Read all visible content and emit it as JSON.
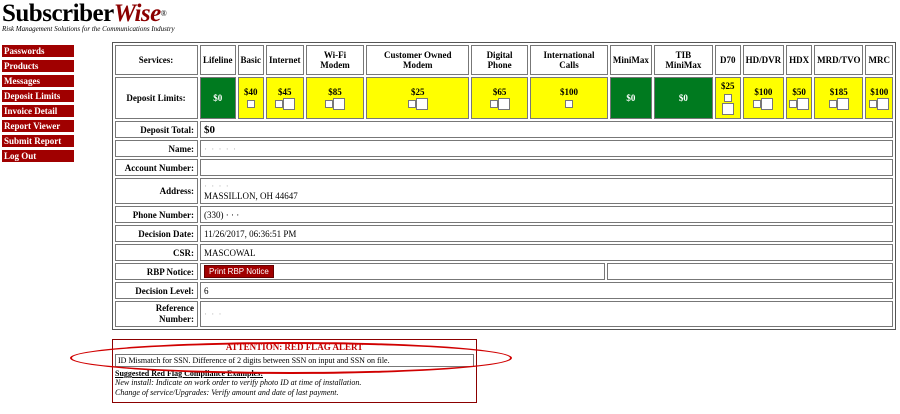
{
  "logo": {
    "part1": "Subscriber",
    "part2": "Wise",
    "reg": "®",
    "tagline": "Risk Management Solutions for the Communications Industry"
  },
  "menu": [
    "Passwords",
    "Products",
    "Messages",
    "Deposit Limits",
    "Invoice Detail",
    "Report Viewer",
    "Submit Report",
    "Log Out"
  ],
  "services_label": "Services:",
  "deposit_limits_label": "Deposit Limits:",
  "services": [
    {
      "name": "Lifeline",
      "limit": "$0",
      "color": "green",
      "checkbox": false,
      "box": false
    },
    {
      "name": "Basic",
      "limit": "$40",
      "color": "yellow",
      "checkbox": true,
      "box": false
    },
    {
      "name": "Internet",
      "limit": "$45",
      "color": "yellow",
      "checkbox": true,
      "box": true
    },
    {
      "name": "Wi-Fi Modem",
      "limit": "$85",
      "color": "yellow",
      "checkbox": true,
      "box": true
    },
    {
      "name": "Customer Owned Modem",
      "limit": "$25",
      "color": "yellow",
      "checkbox": true,
      "box": true
    },
    {
      "name": "Digital Phone",
      "limit": "$65",
      "color": "yellow",
      "checkbox": true,
      "box": true
    },
    {
      "name": "International Calls",
      "limit": "$100",
      "color": "yellow",
      "checkbox": true,
      "box": false
    },
    {
      "name": "MiniMax",
      "limit": "$0",
      "color": "green",
      "checkbox": false,
      "box": false
    },
    {
      "name": "TIB MiniMax",
      "limit": "$0",
      "color": "green",
      "checkbox": false,
      "box": false
    },
    {
      "name": "D70",
      "limit": "$25",
      "color": "yellow",
      "checkbox": true,
      "box": true
    },
    {
      "name": "HD/DVR",
      "limit": "$100",
      "color": "yellow",
      "checkbox": true,
      "box": true
    },
    {
      "name": "HDX",
      "limit": "$50",
      "color": "yellow",
      "checkbox": true,
      "box": true
    },
    {
      "name": "MRD/TVO",
      "limit": "$185",
      "color": "yellow",
      "checkbox": true,
      "box": true
    },
    {
      "name": "MRC",
      "limit": "$100",
      "color": "yellow",
      "checkbox": true,
      "box": true
    }
  ],
  "colors": {
    "yellow": "#ffff00",
    "green": "#007a1f",
    "menu": "#a00000",
    "alert": "#c00000"
  },
  "fields": {
    "deposit_total": {
      "label": "Deposit Total:",
      "value": "$0"
    },
    "name": {
      "label": "Name:",
      "value": "· · · · ·"
    },
    "account": {
      "label": "Account Number:",
      "value": ""
    },
    "address": {
      "label": "Address:",
      "line1": "· · · ·",
      "line2": "MASSILLON, OH 44647"
    },
    "phone": {
      "label": "Phone Number:",
      "value": "(330) · · ·"
    },
    "decision_date": {
      "label": "Decision Date:",
      "value": "11/26/2017, 06:36:51 PM"
    },
    "csr": {
      "label": "CSR:",
      "value": "MASCOWAL"
    },
    "rbp": {
      "label": "RBP Notice:",
      "button": "Print RBP Notice"
    },
    "decision_level": {
      "label": "Decision Level:",
      "value": "6"
    },
    "reference": {
      "label1": "Reference",
      "label2": "Number:",
      "value": "· · ·"
    }
  },
  "alert": {
    "title": "ATTENTION: RED FLAG ALERT",
    "message": "ID Mismatch for SSN. Difference of 2 digits between SSN on input and SSN on file.",
    "examples_title": "Suggested Red Flag Compliance Examples:",
    "example1": "New install: Indicate on work order to verify photo ID at time of installation.",
    "example2": "Change of service/Upgrades: Verify amount and date of last payment."
  }
}
